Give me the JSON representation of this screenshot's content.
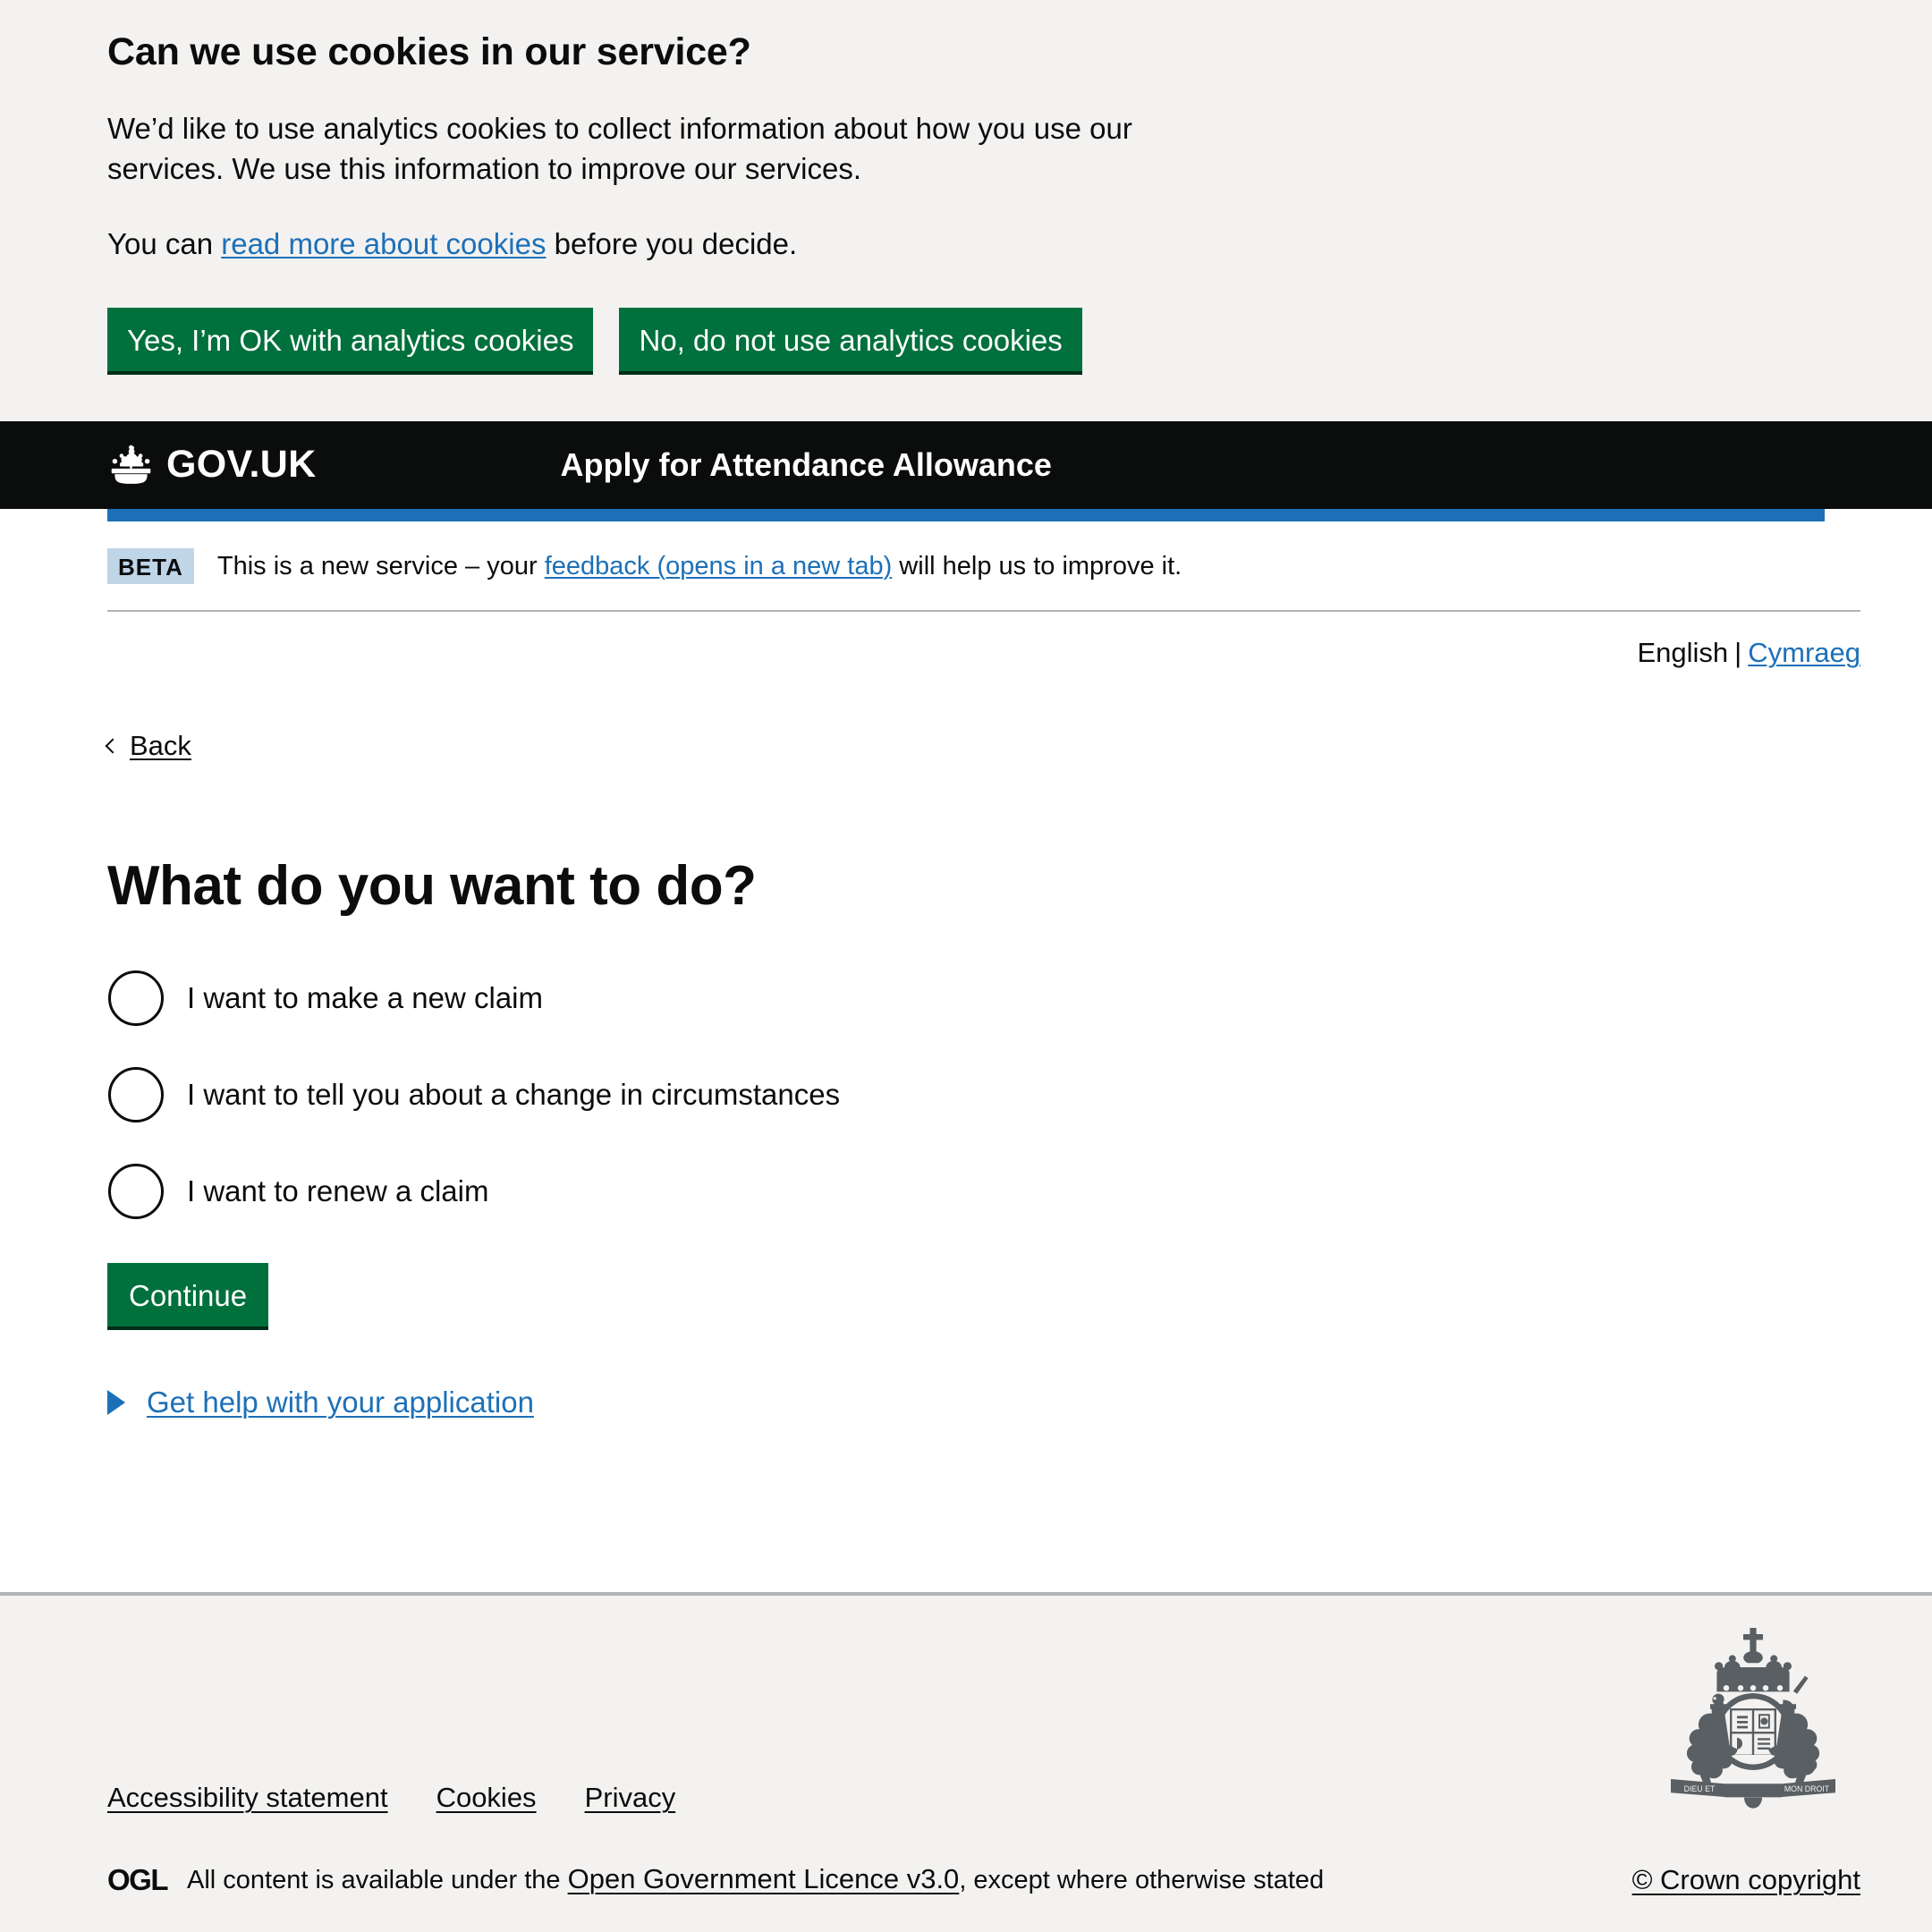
{
  "cookie_banner": {
    "heading": "Can we use cookies in our service?",
    "paragraph_1": "We’d like to use analytics cookies to collect information about how you use our services. We use this information to improve our services.",
    "paragraph_2_before": "You can ",
    "read_more_link": "read more about cookies",
    "paragraph_2_after": " before you decide.",
    "accept_button": "Yes, I’m OK with analytics cookies",
    "reject_button": "No, do not use analytics cookies",
    "background_color": "#f3f2f1",
    "button_color": "#00703c"
  },
  "header": {
    "logo_text": "GOV.UK",
    "crown_icon": "crown-icon",
    "service_name": "Apply for Attendance Allowance",
    "background_color": "#0b0c0c",
    "accent_bar_color": "#1d70b8"
  },
  "phase_banner": {
    "tag": "BETA",
    "text_before": "This is a new service – your ",
    "feedback_link": "feedback (opens in a new tab)",
    "text_after": " will help us to improve it.",
    "tag_background": "#bfd5e8"
  },
  "language_toggle": {
    "current": "English",
    "separator": "|",
    "alternative": "Cymraeg"
  },
  "back": {
    "label": "Back",
    "icon": "chevron-left-icon"
  },
  "main": {
    "heading": "What do you want to do?",
    "radios": [
      {
        "label": "I want to make a new claim",
        "selected": false
      },
      {
        "label": "I want to tell you about a change in circumstances",
        "selected": false
      },
      {
        "label": "I want to renew a claim",
        "selected": false
      }
    ],
    "continue_button": "Continue",
    "details_summary": "Get help with your application",
    "details_icon": "triangle-right-icon"
  },
  "footer": {
    "links": [
      "Accessibility statement",
      "Cookies",
      "Privacy"
    ],
    "ogl_logo_text": "OGL",
    "licence_before": "All content is available under the ",
    "licence_link": "Open Government Licence v3.0",
    "licence_after": ", except where otherwise stated",
    "copyright": "© Crown copyright",
    "crest_icon": "royal-coat-of-arms-icon",
    "background_color": "#f3f2f1",
    "border_color": "#b1b4b6"
  }
}
